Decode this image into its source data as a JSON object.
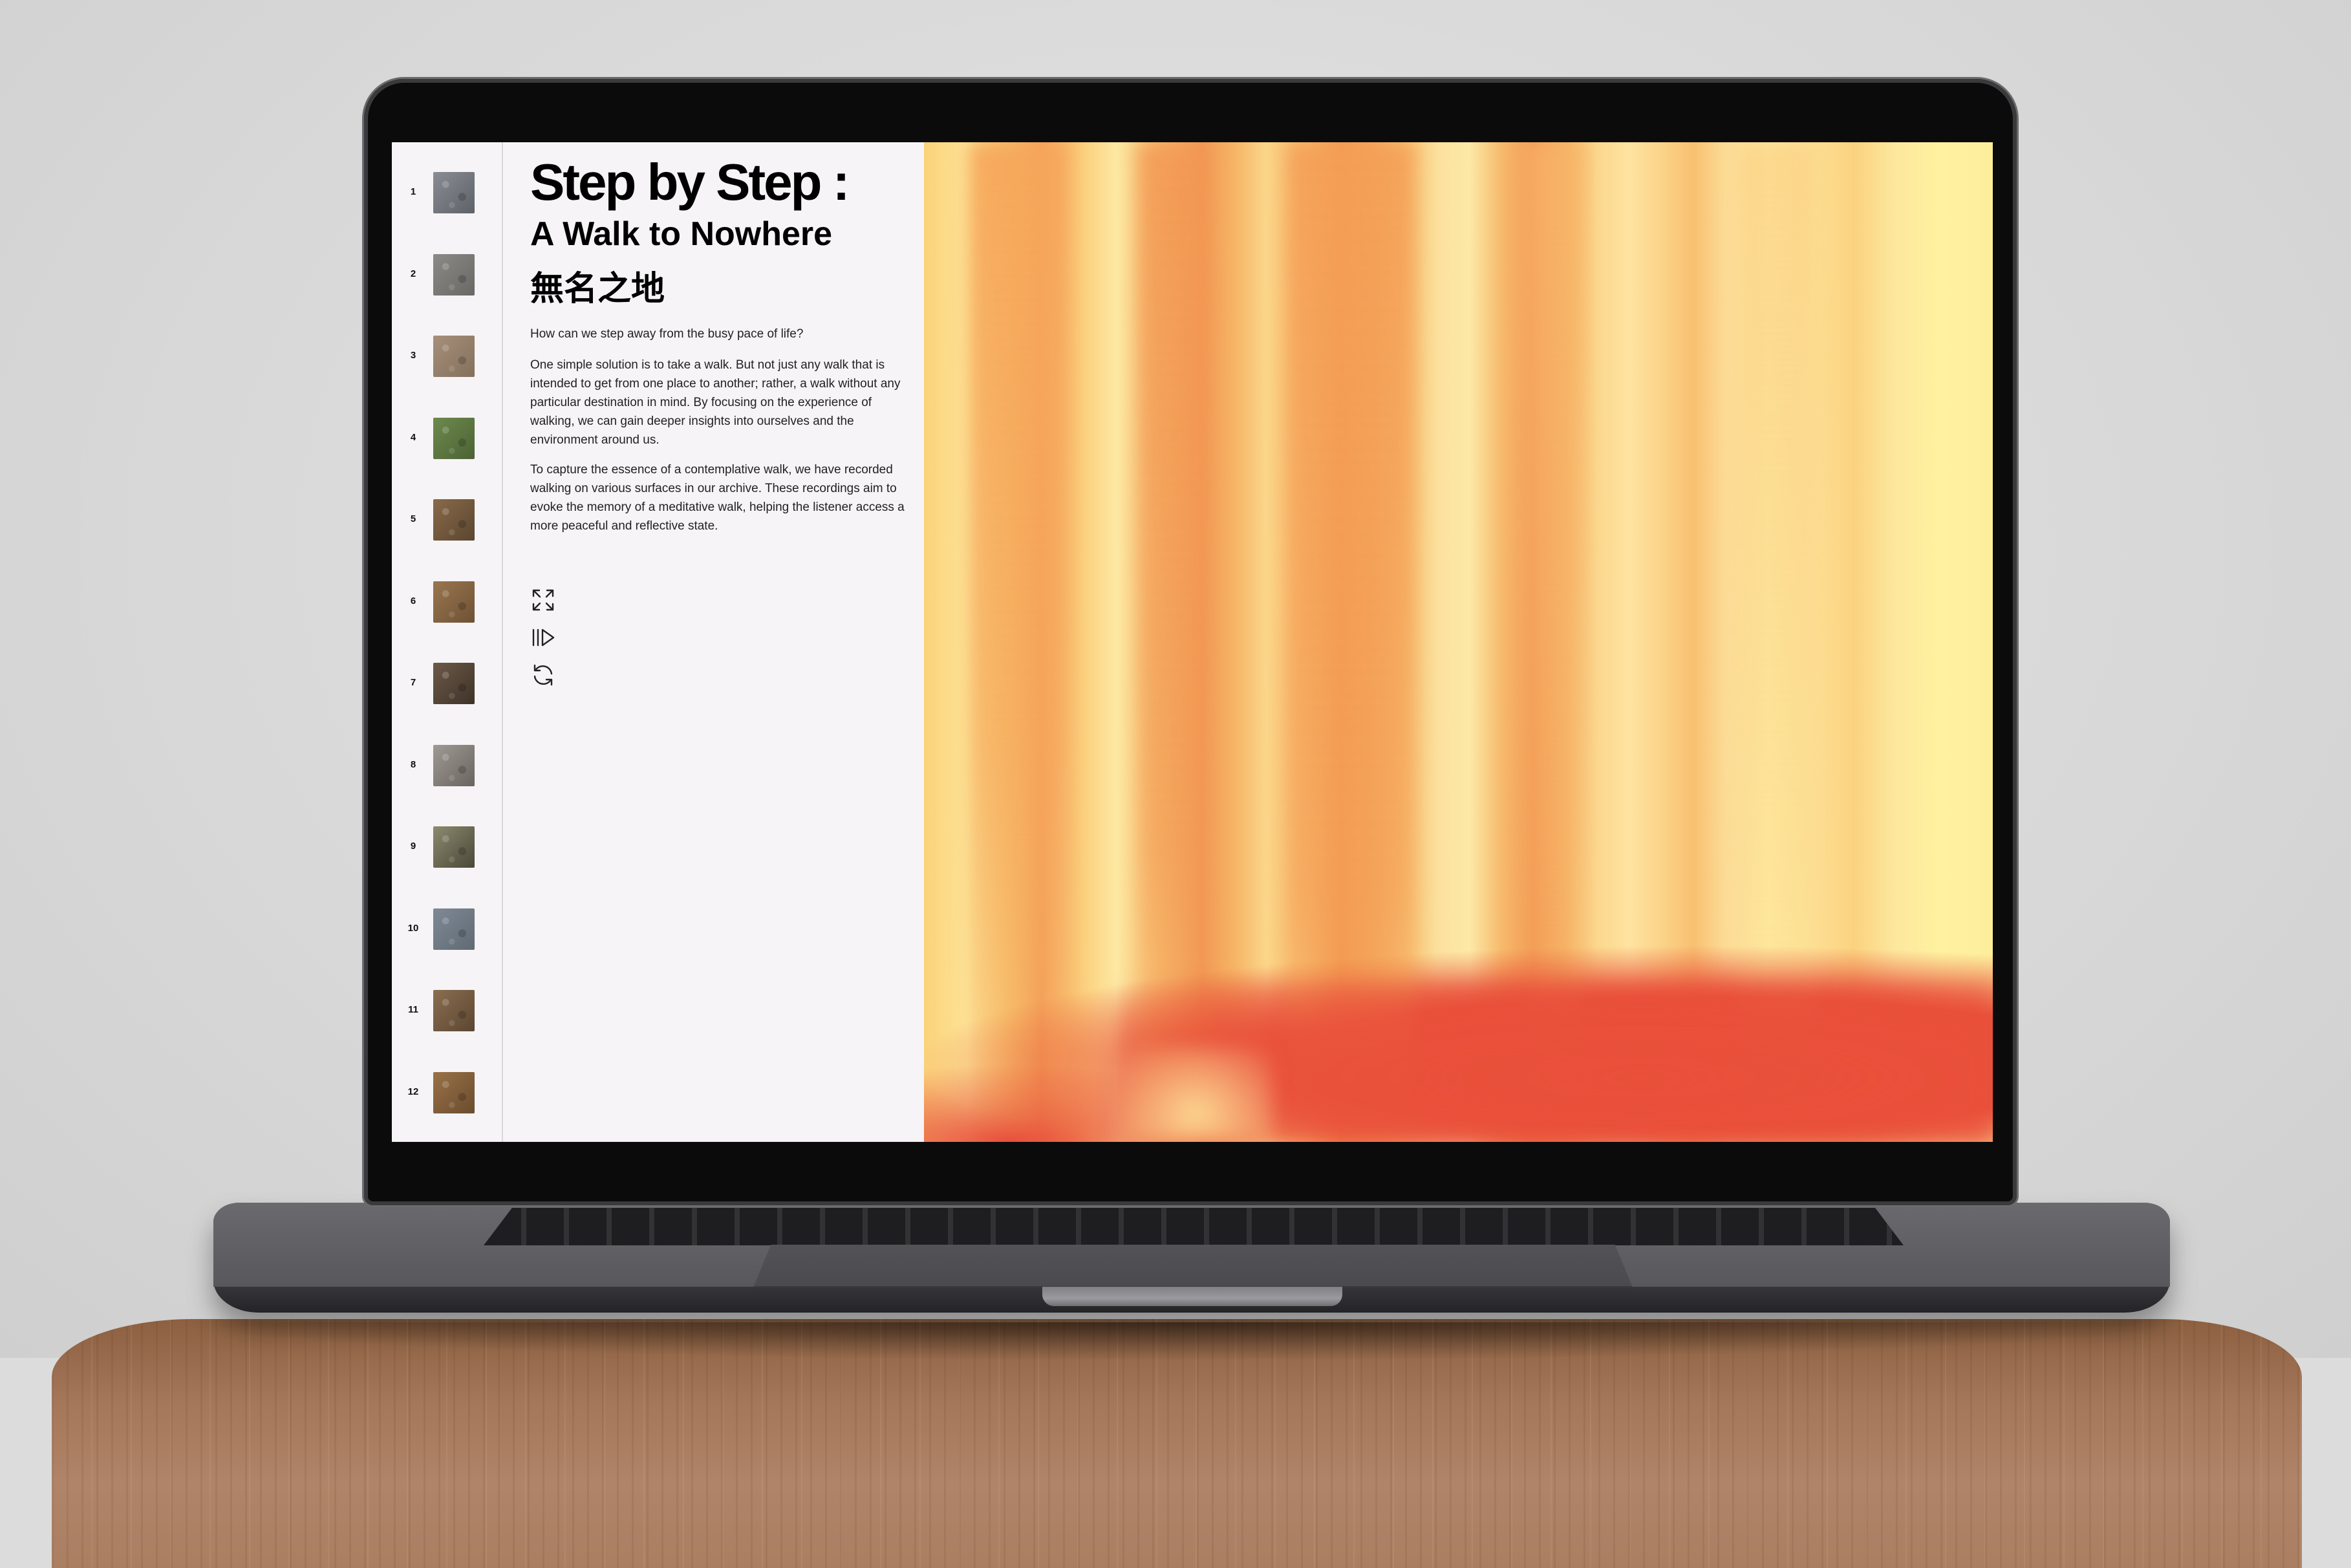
{
  "page": {
    "title": "Step by Step :",
    "subtitle": "A Walk to Nowhere",
    "subtitle_cn": "無名之地",
    "paragraphs": [
      "How can we step away from the busy pace of life?",
      "One simple solution is to take a walk. But not just any walk that is intended to get from one place to another; rather, a walk without any particular destination in mind. By focusing on the experience of walking, we can gain deeper insights into ourselves and the environment around us.",
      "To capture the essence of a contemplative walk, we have recorded walking on various surfaces in our archive. These recordings aim to evoke the memory of a meditative walk, helping the listener access a more peaceful and reflective state."
    ]
  },
  "tracks": [
    {
      "num": "1",
      "color_a": "#8a8e94",
      "color_b": "#5e6268"
    },
    {
      "num": "2",
      "color_a": "#8c8a86",
      "color_b": "#6a6864"
    },
    {
      "num": "3",
      "color_a": "#a6907a",
      "color_b": "#84705c"
    },
    {
      "num": "4",
      "color_a": "#6e8a4e",
      "color_b": "#4c6234"
    },
    {
      "num": "5",
      "color_a": "#8a6a4a",
      "color_b": "#5a4630"
    },
    {
      "num": "6",
      "color_a": "#9a7650",
      "color_b": "#6e5234"
    },
    {
      "num": "7",
      "color_a": "#6c5a48",
      "color_b": "#3e3228"
    },
    {
      "num": "8",
      "color_a": "#a09a94",
      "color_b": "#6a6460"
    },
    {
      "num": "9",
      "color_a": "#8c8a6e",
      "color_b": "#4a4838"
    },
    {
      "num": "10",
      "color_a": "#7e8a96",
      "color_b": "#606a74"
    },
    {
      "num": "11",
      "color_a": "#8a6e50",
      "color_b": "#5c4632"
    },
    {
      "num": "12",
      "color_a": "#9a7248",
      "color_b": "#6a4c2e"
    }
  ],
  "controls": [
    {
      "name": "fullscreen-icon"
    },
    {
      "name": "play-pause-icon"
    },
    {
      "name": "refresh-icon"
    }
  ],
  "colors": {
    "page_bg": "#f6f4f6",
    "accent_red": "#e9503b",
    "accent_yellow": "#fde497"
  }
}
